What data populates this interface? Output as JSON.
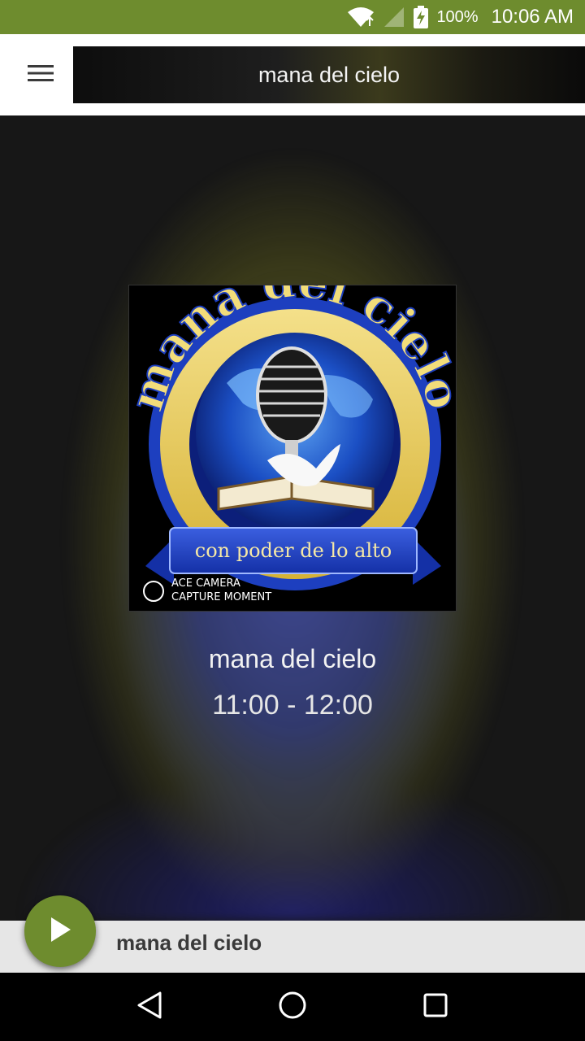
{
  "status_bar": {
    "battery_percent": "100%",
    "time": "10:06 AM",
    "icons": [
      "wifi-icon",
      "signal-icon",
      "battery-charging-icon"
    ]
  },
  "app_bar": {
    "menu_icon": "hamburger-menu-icon",
    "title": "mana del cielo"
  },
  "now_playing": {
    "artwork": {
      "arc_text": "mana del cielo",
      "ribbon_text": "con poder de lo alto",
      "watermark_line1": "ACE CAMERA",
      "watermark_line2": "CAPTURE MOMENT"
    },
    "station_name": "mana del cielo",
    "program_time": "11:00 - 12:00"
  },
  "mini_player": {
    "title": "mana del cielo",
    "play_icon": "play-icon"
  },
  "nav_bar": {
    "buttons": [
      "back-icon",
      "home-icon",
      "recents-icon"
    ]
  },
  "colors": {
    "accent": "#6e8c2e",
    "app_bar_bg": "#ffffff",
    "mini_player_bg": "#e6e6e6"
  }
}
